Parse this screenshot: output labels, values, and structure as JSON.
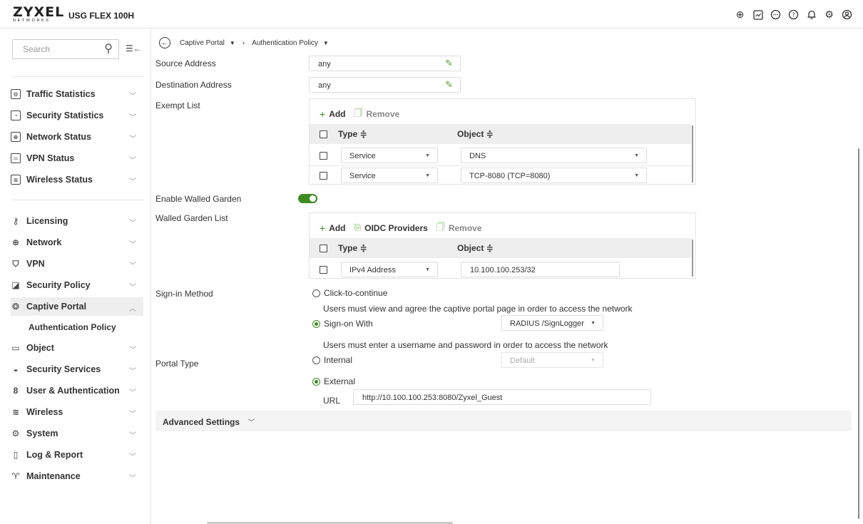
{
  "header": {
    "logo_main": "ZYXEL",
    "logo_sub": "NETWORKS",
    "model": "USG FLEX 100H",
    "icons": [
      "globe-icon",
      "monitor-icon",
      "chat-icon",
      "help-icon",
      "bell-icon",
      "gear-icon",
      "user-icon"
    ]
  },
  "sidebar": {
    "search_placeholder": "Search",
    "group1": [
      {
        "label": "Traffic Statistics",
        "icon": "traffic-statistics-icon"
      },
      {
        "label": "Security Statistics",
        "icon": "security-statistics-icon"
      },
      {
        "label": "Network Status",
        "icon": "network-status-icon"
      },
      {
        "label": "VPN Status",
        "icon": "vpn-status-icon"
      },
      {
        "label": "Wireless Status",
        "icon": "wireless-status-icon"
      }
    ],
    "group2": [
      {
        "label": "Licensing",
        "icon": "licensing-icon"
      },
      {
        "label": "Network",
        "icon": "network-icon"
      },
      {
        "label": "VPN",
        "icon": "vpn-icon"
      },
      {
        "label": "Security Policy",
        "icon": "security-policy-icon"
      },
      {
        "label": "Captive Portal",
        "icon": "captive-portal-icon"
      },
      {
        "label": "Object",
        "icon": "object-icon"
      },
      {
        "label": "Security Services",
        "icon": "security-services-icon"
      },
      {
        "label": "User & Authentication",
        "icon": "user-authentication-icon"
      },
      {
        "label": "Wireless",
        "icon": "wireless-icon"
      },
      {
        "label": "System",
        "icon": "system-icon"
      },
      {
        "label": "Log & Report",
        "icon": "log-report-icon"
      },
      {
        "label": "Maintenance",
        "icon": "maintenance-icon"
      }
    ],
    "sub_item": "Authentication Policy"
  },
  "breadcrumb": {
    "item1": "Captive Portal",
    "item2": "Authentication Policy"
  },
  "form": {
    "source_address_label": "Source Address",
    "source_address_value": "any",
    "destination_address_label": "Destination Address",
    "destination_address_value": "any",
    "exempt_list_label": "Exempt List",
    "enable_walled_garden_label": "Enable Walled Garden",
    "walled_garden_enabled": true,
    "walled_garden_list_label": "Walled Garden List",
    "sign_in_method_label": "Sign-in Method",
    "portal_type_label": "Portal Type"
  },
  "exempt_list": {
    "add_label": "Add",
    "remove_label": "Remove",
    "col_type": "Type ≑",
    "col_object": "Object ≑",
    "rows": [
      {
        "type": "Service",
        "object": "DNS"
      },
      {
        "type": "Service",
        "object": "TCP-8080 (TCP=8080)"
      }
    ]
  },
  "walled_garden_list": {
    "add_label": "Add",
    "oidc_label": "OIDC Providers",
    "remove_label": "Remove",
    "col_type": "Type ≑",
    "col_object": "Object ≑",
    "rows": [
      {
        "type": "IPv4 Address",
        "object": "10.100.100.253/32"
      }
    ]
  },
  "sign_in": {
    "option1": "Click-to-continue",
    "option1_help": "Users must view and agree the captive portal page in order to access the network",
    "option2": "Sign-on With",
    "option2_value": "RADIUS /SignLogger",
    "option2_help": "Users must enter a username and password in order to access the network",
    "selected": "Sign-on With"
  },
  "portal_type": {
    "option_internal": "Internal",
    "internal_value": "Default",
    "option_external": "External",
    "url_label": "URL",
    "url_value": "http://10.100.100.253:8080/Zyxel_Guest",
    "selected": "External"
  },
  "advanced": {
    "label": "Advanced Settings"
  }
}
